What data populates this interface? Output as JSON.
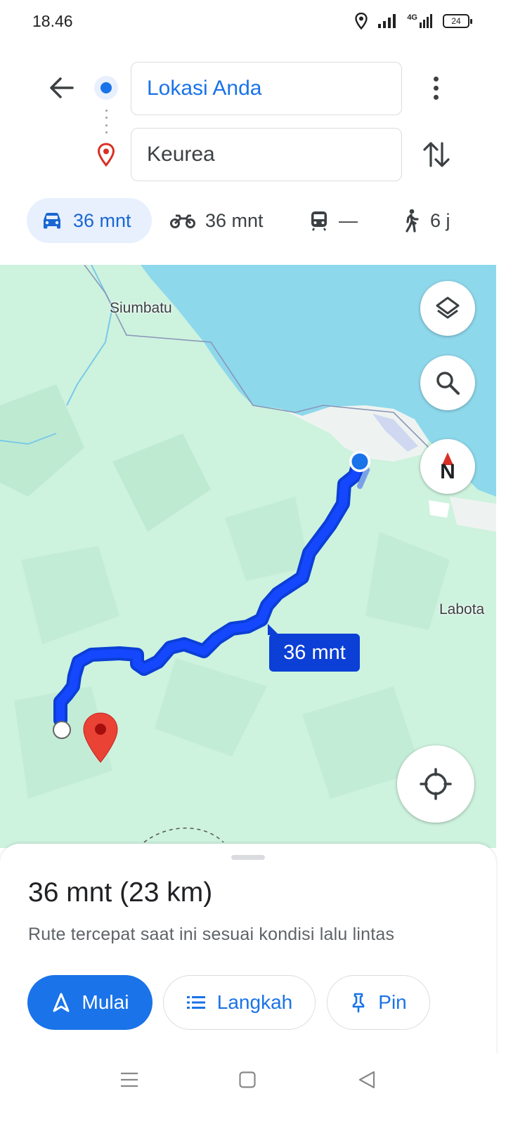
{
  "status_bar": {
    "time": "18.46",
    "network": "4G",
    "battery": "24"
  },
  "route": {
    "origin": "Lokasi Anda",
    "destination": "Keurea"
  },
  "modes": {
    "car": "36 mnt",
    "motorcycle": "36 mnt",
    "transit": "—",
    "walk": "6 j"
  },
  "map": {
    "labels": {
      "siumbatu": "Siumbatu",
      "labota": "Labota"
    },
    "route_duration": "36 mnt",
    "compass": "N"
  },
  "sheet": {
    "summary": "36 mnt (23 km)",
    "subtitle": "Rute tercepat saat ini sesuai kondisi lalu lintas",
    "start_label": "Mulai",
    "steps_label": "Langkah",
    "pin_label": "Pin"
  },
  "colors": {
    "accent": "#1a73e8",
    "route": "#0b3fd6",
    "water": "#8ed8ec",
    "land": "#cdf2de",
    "pin": "#ea4335"
  },
  "icons": [
    "back-arrow-icon",
    "more-vert-icon",
    "swap-icon",
    "car-icon",
    "motorcycle-icon",
    "train-icon",
    "walk-icon",
    "layers-icon",
    "search-icon",
    "compass-icon",
    "my-location-icon",
    "navigation-icon",
    "list-icon",
    "pin-icon",
    "destination-pin-icon"
  ]
}
